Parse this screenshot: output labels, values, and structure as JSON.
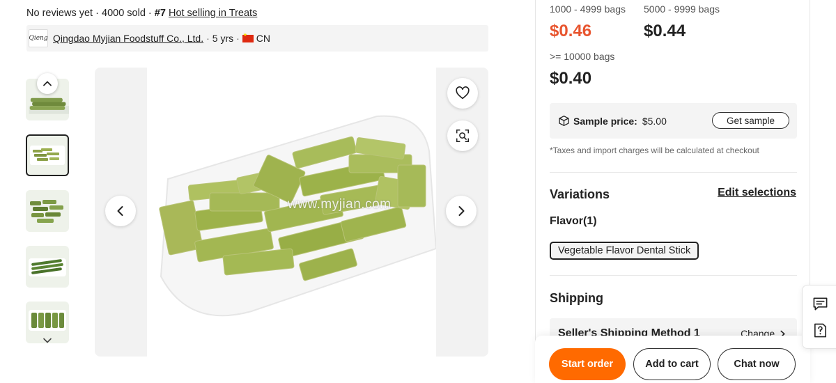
{
  "meta": {
    "reviews": "No reviews yet",
    "sold": "4000 sold",
    "rank": "#7",
    "rank_link": "Hot selling in Treats",
    "separator": "·"
  },
  "supplier": {
    "logo_text": "Qieng",
    "name": "Qingdao Myjian Foodstuff Co., Ltd.",
    "years": "5 yrs",
    "country": "CN"
  },
  "gallery": {
    "thumbnails": [
      {
        "active": false
      },
      {
        "active": true
      },
      {
        "active": false
      },
      {
        "active": false
      },
      {
        "active": false
      }
    ],
    "watermark": "www.myjian.com"
  },
  "pricing": {
    "tiers": [
      {
        "range": "1000 - 4999 bags",
        "price": "$0.46",
        "accent": true
      },
      {
        "range": "5000 - 9999 bags",
        "price": "$0.44",
        "accent": false
      },
      {
        "range": ">= 10000 bags",
        "price": "$0.40",
        "accent": false
      }
    ],
    "accent_color": "#e8552f"
  },
  "sample": {
    "label": "Sample price:",
    "price": "$5.00",
    "button": "Get sample"
  },
  "tax_note": "*Taxes and import charges will be calculated at checkout",
  "variations": {
    "title": "Variations",
    "edit_link": "Edit selections",
    "flavor_label": "Flavor(1)",
    "flavor_option": "Vegetable Flavor Dental Stick"
  },
  "shipping": {
    "title": "Shipping",
    "method": "Seller's Shipping Method 1",
    "change": "Change"
  },
  "actions": {
    "start_order": "Start order",
    "add_to_cart": "Add to cart",
    "chat_now": "Chat now",
    "primary_color": "#ff6a00"
  },
  "icons": [
    "chevron-up-icon",
    "chevron-down-icon",
    "chevron-left-icon",
    "chevron-right-icon",
    "heart-icon",
    "image-search-icon",
    "box-icon",
    "message-icon",
    "feedback-icon"
  ]
}
